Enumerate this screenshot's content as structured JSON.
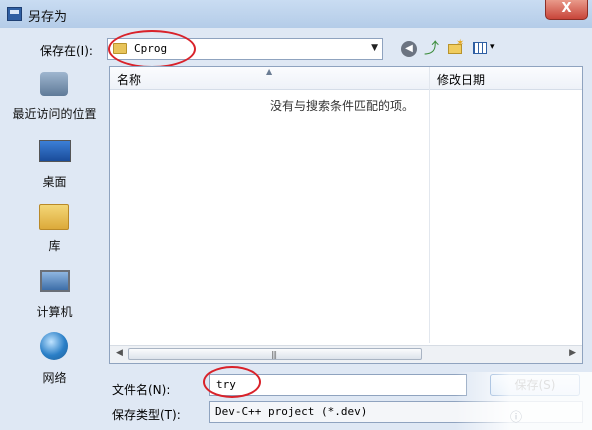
{
  "window": {
    "title": "另存为",
    "close_label": "X"
  },
  "lookin": {
    "label": "保存在(I):",
    "value": "Cprog"
  },
  "toolbar": {
    "back_glyph": "◀",
    "up_glyph": "⤴",
    "newfolder_glyph": "✶",
    "view_glyph": "▾"
  },
  "places": [
    {
      "label": "最近访问的位置",
      "icon": "recent-places-icon"
    },
    {
      "label": "桌面",
      "icon": "desktop-icon"
    },
    {
      "label": "库",
      "icon": "libraries-icon"
    },
    {
      "label": "计算机",
      "icon": "computer-icon"
    },
    {
      "label": "网络",
      "icon": "network-icon"
    }
  ],
  "filelist": {
    "columns": [
      "名称",
      "修改日期"
    ],
    "empty_message": "没有与搜索条件匹配的项。"
  },
  "filename": {
    "label": "文件名(N):",
    "value": "try"
  },
  "filetype": {
    "label": "保存类型(T):",
    "value": "Dev-C++ project (*.dev)"
  },
  "buttons": {
    "save": "保存(S)"
  },
  "watermark": "ⓘ"
}
